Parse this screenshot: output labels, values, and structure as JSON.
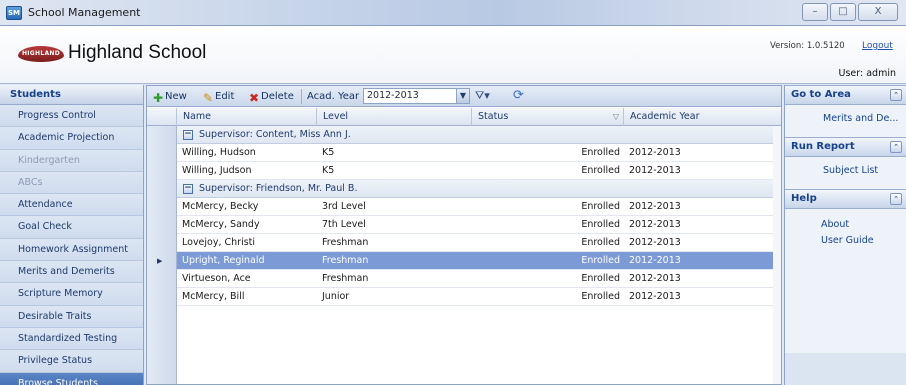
{
  "window": {
    "title": "School Management",
    "app_icon_text": "SM",
    "buttons": [
      "–",
      "□",
      "X"
    ]
  },
  "header": {
    "school_name": "Highland School",
    "logo_text": "HIGHLAND",
    "version": "Version: 1.0.5120",
    "logout": "Logout",
    "user": "User: admin"
  },
  "sidebar": {
    "title": "Students",
    "items": [
      {
        "label": "Progress Control",
        "state": "normal"
      },
      {
        "label": "Academic Projection",
        "state": "normal"
      },
      {
        "label": "Kindergarten",
        "state": "disabled"
      },
      {
        "label": "ABCs",
        "state": "disabled"
      },
      {
        "label": "Attendance",
        "state": "normal"
      },
      {
        "label": "Goal Check",
        "state": "normal"
      },
      {
        "label": "Homework Assignment",
        "state": "normal"
      },
      {
        "label": "Merits and Demerits",
        "state": "normal"
      },
      {
        "label": "Scripture Memory",
        "state": "normal"
      },
      {
        "label": "Desirable Traits",
        "state": "normal"
      },
      {
        "label": "Standardized Testing",
        "state": "normal"
      },
      {
        "label": "Privilege Status",
        "state": "normal"
      },
      {
        "label": "Browse Students",
        "state": "active"
      }
    ]
  },
  "toolbar": {
    "new_label": "New",
    "edit_label": "Edit",
    "delete_label": "Delete",
    "acad_year_label": "Acad. Year",
    "acad_year_value": "2012-2013"
  },
  "grid": {
    "columns": [
      "Name",
      "Level",
      "Status",
      "Academic Year"
    ],
    "groups": [
      {
        "label": "Supervisor: Content, Miss Ann J.",
        "rows": [
          {
            "name": "Willing, Hudson",
            "level": "K5",
            "status": "Enrolled",
            "year": "2012-2013"
          },
          {
            "name": "Willing, Judson",
            "level": "K5",
            "status": "Enrolled",
            "year": "2012-2013"
          }
        ]
      },
      {
        "label": "Supervisor: Friendson, Mr. Paul B.",
        "rows": [
          {
            "name": "McMercy, Becky",
            "level": "3rd Level",
            "status": "Enrolled",
            "year": "2012-2013"
          },
          {
            "name": "McMercy, Sandy",
            "level": "7th Level",
            "status": "Enrolled",
            "year": "2012-2013"
          },
          {
            "name": "Lovejoy, Christi",
            "level": "Freshman",
            "status": "Enrolled",
            "year": "2012-2013"
          },
          {
            "name": "Upright, Reginald",
            "level": "Freshman",
            "status": "Enrolled",
            "year": "2012-2013",
            "selected": true
          },
          {
            "name": "Virtueson, Ace",
            "level": "Freshman",
            "status": "Enrolled",
            "year": "2012-2013"
          },
          {
            "name": "McMercy, Bill",
            "level": "Junior",
            "status": "Enrolled",
            "year": "2012-2013"
          }
        ]
      }
    ]
  },
  "right_panel": {
    "go_to_area": {
      "title": "Go to Area",
      "links": [
        "Merits and De..."
      ]
    },
    "run_report": {
      "title": "Run Report",
      "links": [
        "Subject List"
      ]
    },
    "help": {
      "title": "Help",
      "links": [
        "About",
        "User Guide"
      ]
    }
  }
}
